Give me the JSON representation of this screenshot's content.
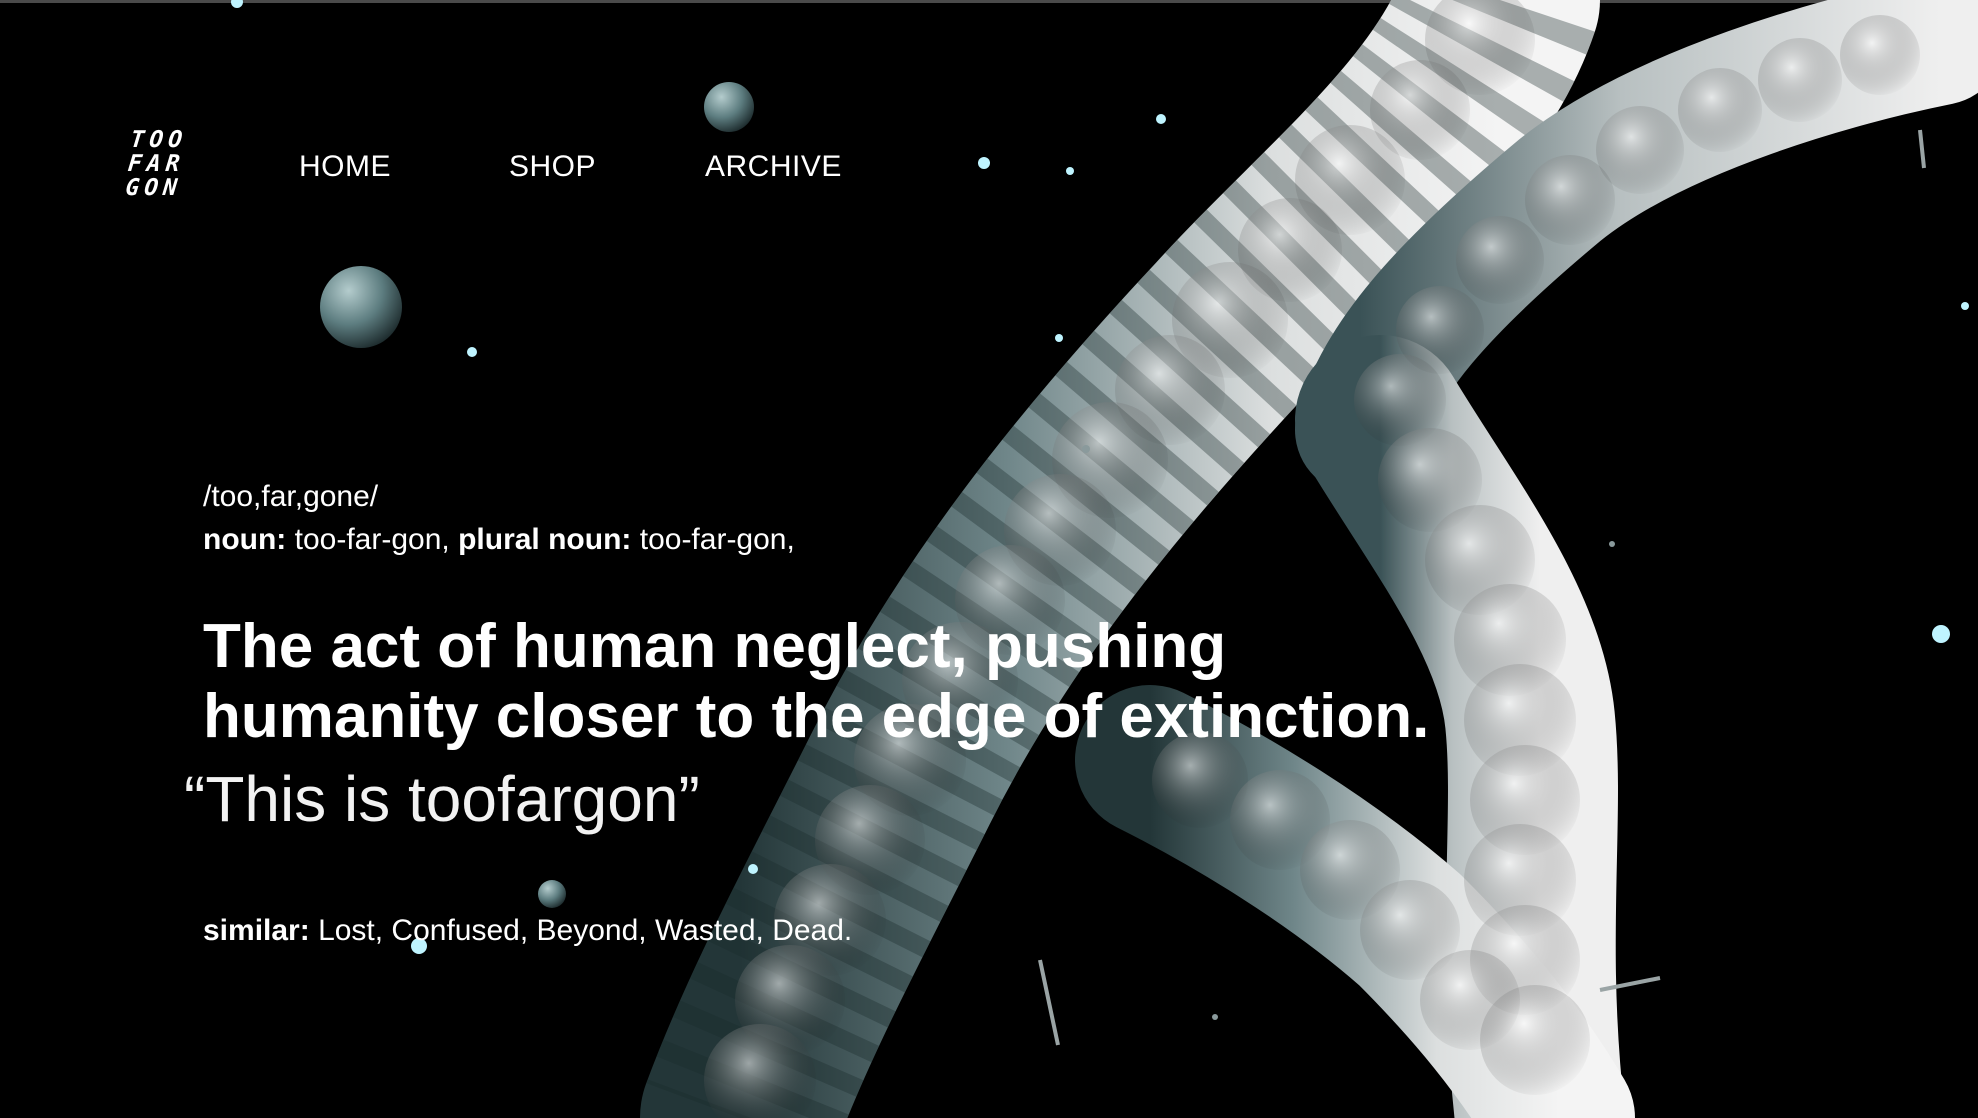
{
  "brand": {
    "logo_lines": [
      "TOO",
      "FAR",
      "GON"
    ]
  },
  "nav": {
    "items": [
      {
        "label": "HOME"
      },
      {
        "label": "SHOP"
      },
      {
        "label": "ARCHIVE"
      }
    ]
  },
  "hero": {
    "pronunciation": "/too,far,gone/",
    "noun_label": "noun:",
    "noun_value": "too-far-gon,",
    "plural_label": "plural noun:",
    "plural_value": "too-far-gon,",
    "definition_lines": [
      "The act of human neglect, pushing",
      "humanity closer to the edge of extinction."
    ],
    "quote": "“This is toofargon”",
    "similar_label": "similar:",
    "similar_value": "Lost, Confused, Beyond, Wasted, Dead."
  },
  "colors": {
    "background": "#000000",
    "text": "#ffffff",
    "particle": "#bff4ff",
    "sphere": "#6d8f92",
    "helix_light": "#e6e8e8",
    "helix_shadow": "#31474b"
  }
}
